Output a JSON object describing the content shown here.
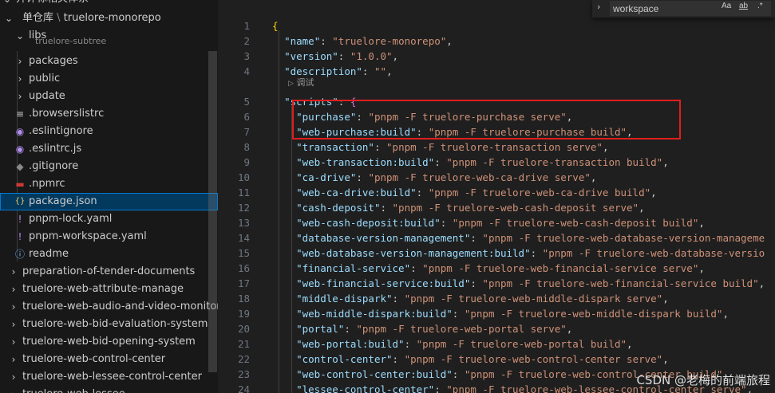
{
  "sidebar": {
    "top_cut_label": "开评标相关体系",
    "workspace_folder": "单仓库",
    "workspace_path": "truelore-monorepo",
    "items": [
      {
        "label": "libs",
        "kind": "folder-open",
        "icon": "chevron-down-icon"
      },
      {
        "label": "truelore-subtree",
        "kind": "folder",
        "icon": "chevron-right-icon"
      },
      {
        "label": "packages",
        "kind": "folder",
        "icon": "chevron-right-icon"
      },
      {
        "label": "public",
        "kind": "folder",
        "icon": "chevron-right-icon"
      },
      {
        "label": "update",
        "kind": "folder",
        "icon": "chevron-right-icon"
      },
      {
        "label": ".browserslistrc",
        "kind": "file",
        "icon": "lines-icon"
      },
      {
        "label": ".eslintignore",
        "kind": "file",
        "icon": "eslint-icon"
      },
      {
        "label": ".eslintrc.js",
        "kind": "file",
        "icon": "eslint-icon"
      },
      {
        "label": ".gitignore",
        "kind": "file",
        "icon": "git-icon"
      },
      {
        "label": ".npmrc",
        "kind": "file",
        "icon": "npm-icon"
      },
      {
        "label": "package.json",
        "kind": "file",
        "icon": "json-icon"
      },
      {
        "label": "pnpm-lock.yaml",
        "kind": "file",
        "icon": "yaml-icon"
      },
      {
        "label": "pnpm-workspace.yaml",
        "kind": "file",
        "icon": "yaml-icon"
      },
      {
        "label": "readme",
        "kind": "file",
        "icon": "info-icon"
      },
      {
        "label": "preparation-of-tender-documents",
        "kind": "folder",
        "icon": "chevron-right-icon"
      },
      {
        "label": "truelore-web-attribute-manage",
        "kind": "folder",
        "icon": "chevron-right-icon"
      },
      {
        "label": "truelore-web-audio-and-video-monitor",
        "kind": "folder",
        "icon": "chevron-right-icon"
      },
      {
        "label": "truelore-web-bid-evaluation-system",
        "kind": "folder",
        "icon": "chevron-right-icon"
      },
      {
        "label": "truelore-web-bid-opening-system",
        "kind": "folder",
        "icon": "chevron-right-icon"
      },
      {
        "label": "truelore-web-control-center",
        "kind": "folder",
        "icon": "chevron-right-icon"
      },
      {
        "label": "truelore-web-lessee-control-center",
        "kind": "folder",
        "icon": "chevron-right-icon"
      },
      {
        "label": "truelore-web-lessee",
        "kind": "folder",
        "icon": "chevron-right-icon"
      }
    ],
    "selected": "package.json"
  },
  "find": {
    "value": "workspace",
    "match_case": "Aa",
    "whole_word": "ab",
    "regex": ".*"
  },
  "editor": {
    "codelens_label": "调试",
    "lines": [
      {
        "n": "1",
        "tokens": [
          [
            "b1",
            "{"
          ]
        ]
      },
      {
        "n": "2",
        "tokens": [
          [
            "k",
            "\"name\""
          ],
          [
            "p",
            ": "
          ],
          [
            "s",
            "\"truelore-monorepo\""
          ],
          [
            "p",
            ","
          ]
        ]
      },
      {
        "n": "3",
        "tokens": [
          [
            "k",
            "\"version\""
          ],
          [
            "p",
            ": "
          ],
          [
            "s",
            "\"1.0.0\""
          ],
          [
            "p",
            ","
          ]
        ]
      },
      {
        "n": "4",
        "tokens": [
          [
            "k",
            "\"description\""
          ],
          [
            "p",
            ": "
          ],
          [
            "s",
            "\"\""
          ],
          [
            "p",
            ","
          ]
        ]
      },
      {
        "n": "5",
        "tokens": [
          [
            "k",
            "\"scripts\""
          ],
          [
            "p",
            ": "
          ],
          [
            "b2",
            "{"
          ]
        ]
      },
      {
        "n": "6",
        "tokens": [
          [
            "k",
            "\"purchase\""
          ],
          [
            "p",
            ": "
          ],
          [
            "s",
            "\"pnpm -F truelore-purchase serve\""
          ],
          [
            "p",
            ","
          ]
        ]
      },
      {
        "n": "7",
        "tokens": [
          [
            "k",
            "\"web-purchase:build\""
          ],
          [
            "p",
            ": "
          ],
          [
            "s",
            "\"pnpm -F truelore-purchase build\""
          ],
          [
            "p",
            ","
          ]
        ]
      },
      {
        "n": "8",
        "tokens": [
          [
            "k",
            "\"transaction\""
          ],
          [
            "p",
            ": "
          ],
          [
            "s",
            "\"pnpm -F truelore-transaction serve\""
          ],
          [
            "p",
            ","
          ]
        ]
      },
      {
        "n": "9",
        "tokens": [
          [
            "k",
            "\"web-transaction:build\""
          ],
          [
            "p",
            ": "
          ],
          [
            "s",
            "\"pnpm -F truelore-transaction build\""
          ],
          [
            "p",
            ","
          ]
        ]
      },
      {
        "n": "10",
        "tokens": [
          [
            "k",
            "\"ca-drive\""
          ],
          [
            "p",
            ": "
          ],
          [
            "s",
            "\"pnpm -F truelore-web-ca-drive serve\""
          ],
          [
            "p",
            ","
          ]
        ]
      },
      {
        "n": "11",
        "tokens": [
          [
            "k",
            "\"web-ca-drive:build\""
          ],
          [
            "p",
            ": "
          ],
          [
            "s",
            "\"pnpm -F truelore-web-ca-drive build\""
          ],
          [
            "p",
            ","
          ]
        ]
      },
      {
        "n": "12",
        "tokens": [
          [
            "k",
            "\"cash-deposit\""
          ],
          [
            "p",
            ": "
          ],
          [
            "s",
            "\"pnpm -F truelore-web-cash-deposit serve\""
          ],
          [
            "p",
            ","
          ]
        ]
      },
      {
        "n": "13",
        "tokens": [
          [
            "k",
            "\"web-cash-deposit:build\""
          ],
          [
            "p",
            ": "
          ],
          [
            "s",
            "\"pnpm -F truelore-web-cash-deposit build\""
          ],
          [
            "p",
            ","
          ]
        ]
      },
      {
        "n": "14",
        "tokens": [
          [
            "k",
            "\"database-version-management\""
          ],
          [
            "p",
            ": "
          ],
          [
            "s",
            "\"pnpm -F truelore-web-database-version-manageme"
          ]
        ]
      },
      {
        "n": "15",
        "tokens": [
          [
            "k",
            "\"web-database-version-management:build\""
          ],
          [
            "p",
            ": "
          ],
          [
            "s",
            "\"pnpm -F truelore-web-database-versio"
          ]
        ]
      },
      {
        "n": "16",
        "tokens": [
          [
            "k",
            "\"financial-service\""
          ],
          [
            "p",
            ": "
          ],
          [
            "s",
            "\"pnpm -F truelore-web-financial-service serve\""
          ],
          [
            "p",
            ","
          ]
        ]
      },
      {
        "n": "17",
        "tokens": [
          [
            "k",
            "\"web-financial-service:build\""
          ],
          [
            "p",
            ": "
          ],
          [
            "s",
            "\"pnpm -F truelore-web-financial-service build\""
          ],
          [
            "p",
            ","
          ]
        ]
      },
      {
        "n": "18",
        "tokens": [
          [
            "k",
            "\"middle-dispark\""
          ],
          [
            "p",
            ": "
          ],
          [
            "s",
            "\"pnpm -F truelore-web-middle-dispark serve\""
          ],
          [
            "p",
            ","
          ]
        ]
      },
      {
        "n": "19",
        "tokens": [
          [
            "k",
            "\"web-middle-dispark:build\""
          ],
          [
            "p",
            ": "
          ],
          [
            "s",
            "\"pnpm -F truelore-web-middle-dispark build\""
          ],
          [
            "p",
            ","
          ]
        ]
      },
      {
        "n": "20",
        "tokens": [
          [
            "k",
            "\"portal\""
          ],
          [
            "p",
            ": "
          ],
          [
            "s",
            "\"pnpm -F truelore-web-portal serve\""
          ],
          [
            "p",
            ","
          ]
        ]
      },
      {
        "n": "21",
        "tokens": [
          [
            "k",
            "\"web-portal:build\""
          ],
          [
            "p",
            ": "
          ],
          [
            "s",
            "\"pnpm -F truelore-web-portal build\""
          ],
          [
            "p",
            ","
          ]
        ]
      },
      {
        "n": "22",
        "tokens": [
          [
            "k",
            "\"control-center\""
          ],
          [
            "p",
            ": "
          ],
          [
            "s",
            "\"pnpm -F truelore-web-control-center serve\""
          ],
          [
            "p",
            ","
          ]
        ]
      },
      {
        "n": "23",
        "tokens": [
          [
            "k",
            "\"web-control-center:build\""
          ],
          [
            "p",
            ": "
          ],
          [
            "s",
            "\"pnpm -F truelore-web-control-center build\""
          ],
          [
            "p",
            ","
          ]
        ]
      },
      {
        "n": "24",
        "tokens": [
          [
            "k",
            "\"lessee-control-center\""
          ],
          [
            "p",
            ": "
          ],
          [
            "s",
            "\"pnpm -F truelore-web-lessee-control-center serve\""
          ],
          [
            "p",
            ","
          ]
        ]
      }
    ]
  },
  "watermark": "CSDN @老梅的前端旅程",
  "colors": {
    "accent": "#0078d4",
    "highlight_box": "#e01e1e",
    "selected_bg": "#04395e"
  }
}
